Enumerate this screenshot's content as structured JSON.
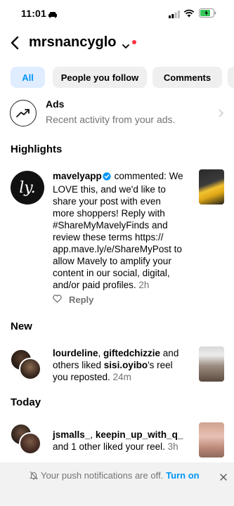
{
  "status_bar": {
    "time": "11:01"
  },
  "header": {
    "account": "mrsnancyglo"
  },
  "filters": [
    {
      "label": "All",
      "active": true
    },
    {
      "label": "People you follow",
      "active": false
    },
    {
      "label": "Comments",
      "active": false
    }
  ],
  "ads": {
    "title": "Ads",
    "subtitle": "Recent activity from your ads."
  },
  "sections": {
    "highlights": "Highlights",
    "new": "New",
    "today": "Today"
  },
  "highlight": {
    "avatar_text": "ly.",
    "user": "mavelyapp",
    "action": "commented:",
    "lines": [
      "We",
      "LOVE this, and we'd like to",
      "share your post with even",
      "more shoppers! Reply with",
      "#ShareMyMavelyFinds and",
      "review these terms https://",
      "app.mave.ly/e/ShareMyPost to",
      "allow Mavely to amplify your",
      "content in our social, digital,",
      "and/or paid profiles."
    ],
    "time": "2h",
    "reply": "Reply"
  },
  "new_notif": {
    "user1": "lourdeline",
    "sep": ", ",
    "user2": "giftedchizzie",
    "mid": " and",
    "line2": "others liked ",
    "user3": "sisi.oyibo",
    "line2_end": "'s reel",
    "line3": "you reposted.",
    "time": "24m"
  },
  "today_notif": {
    "user1": "jsmalls_",
    "sep": ", ",
    "user2": "keepin_up_with_q_",
    "line2": "and 1 other liked your reel.",
    "time": "3h"
  },
  "push": {
    "text": "Your push notifications are off.",
    "action": "Turn on"
  },
  "colors": {
    "accent": "#0095f6",
    "red_dot": "#ff3040",
    "muted": "#737373"
  },
  "icons": [
    "back-icon",
    "chevron-down-icon",
    "trend-icon",
    "verified-icon",
    "heart-icon",
    "bell-off-icon",
    "close-icon"
  ]
}
